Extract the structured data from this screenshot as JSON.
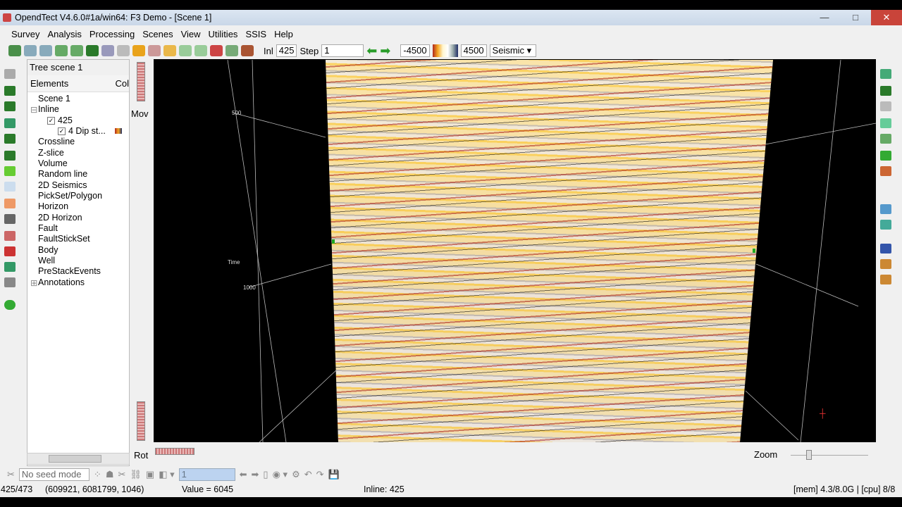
{
  "window": {
    "title": "OpendTect V4.6.0#1a/win64: F3 Demo - [Scene 1]",
    "min": "—",
    "max": "□",
    "close": "✕"
  },
  "menu": [
    "Survey",
    "Analysis",
    "Processing",
    "Scenes",
    "View",
    "Utilities",
    "SSIS",
    "Help"
  ],
  "toolbar": {
    "inl_label": "Inl",
    "inl_value": "425",
    "step_label": "Step",
    "step_value": "1",
    "color_min": "-4500",
    "color_max": "4500",
    "colortable": "Seismic"
  },
  "tree": {
    "title": "Tree scene 1",
    "col_elements": "Elements",
    "col_color": "Col",
    "items": [
      "Scene 1",
      "Inline",
      "425",
      "4 Dip st...",
      "Crossline",
      "Z-slice",
      "Volume",
      "Random line",
      "2D Seismics",
      "PickSet/Polygon",
      "Horizon",
      "2D Horizon",
      "Fault",
      "FaultStickSet",
      "Body",
      "Well",
      "PreStackEvents",
      "Annotations"
    ]
  },
  "viewer": {
    "mov": "Mov",
    "rot": "Rot",
    "zoom": "Zoom",
    "axis_500": "500",
    "axis_time": "Time",
    "axis_1000": "1000"
  },
  "seedbar": {
    "mode": "No seed mode",
    "value": "1"
  },
  "status": {
    "position": "425/473",
    "coords": "(609921, 6081799, 1046)",
    "value": "Value = 6045",
    "inline": "Inline: 425",
    "resources": "[mem] 4.3/8.0G | [cpu] 8/8"
  },
  "colors": {
    "accent": "#2a9d2a",
    "seismic_red": "#b0281c",
    "seismic_yellow": "#f5c542"
  }
}
